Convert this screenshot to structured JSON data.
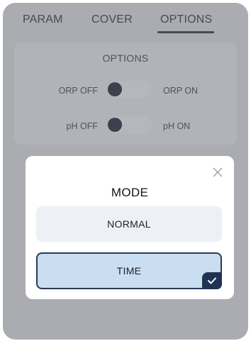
{
  "tabs": [
    {
      "label": "PARAM",
      "active": false
    },
    {
      "label": "COVER",
      "active": false
    },
    {
      "label": "OPTIONS",
      "active": true
    }
  ],
  "options_card": {
    "title": "OPTIONS",
    "rows": [
      {
        "off_label": "ORP OFF",
        "on_label": "ORP ON",
        "state": "off"
      },
      {
        "off_label": "pH OFF",
        "on_label": "pH ON",
        "state": "off"
      }
    ]
  },
  "modal": {
    "title": "MODE",
    "close_icon": "close-icon",
    "options": [
      {
        "label": "NORMAL",
        "selected": false
      },
      {
        "label": "TIME",
        "selected": true
      }
    ],
    "check_icon": "check-icon"
  },
  "colors": {
    "selected_fill": "#c9def0",
    "selected_border": "#2a3a55",
    "knob": "#1d2433"
  }
}
